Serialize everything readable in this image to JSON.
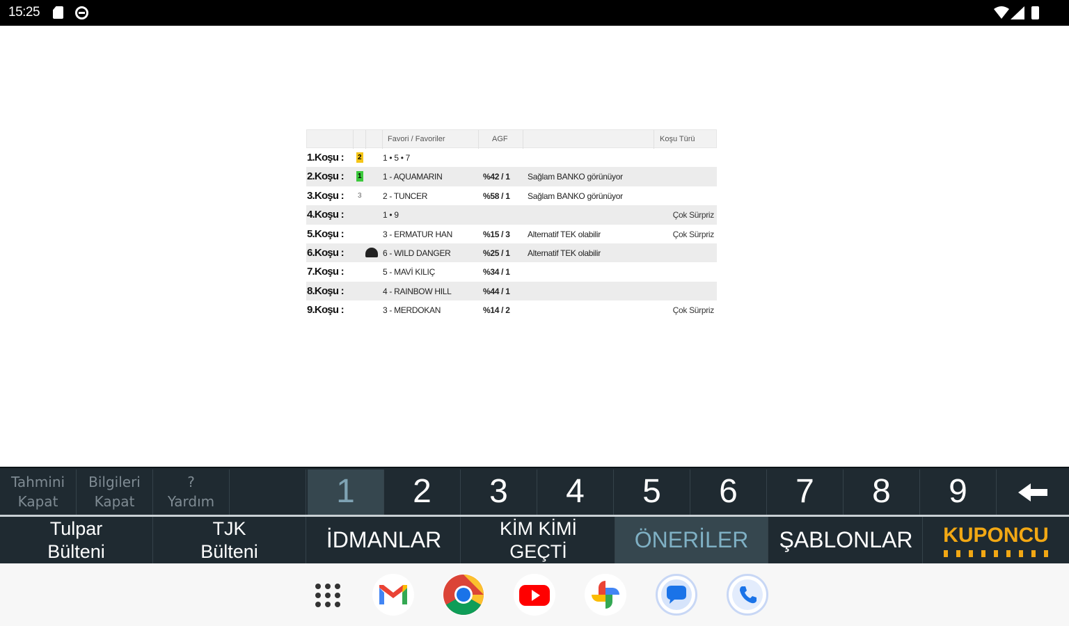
{
  "status_bar": {
    "time": "15:25"
  },
  "table": {
    "headers": {
      "favorites": "Favori / Favoriler",
      "agf": "AGF",
      "race_type": "Koşu Türü"
    },
    "rows": [
      {
        "race": "1.Koşu :",
        "badge": "2",
        "badge_color": "#f5c518",
        "pick": "1 • 5 • 7",
        "agf": "",
        "comment": "",
        "type": ""
      },
      {
        "race": "2.Koşu :",
        "badge": "1",
        "badge_color": "#3cc93c",
        "pick": "1 - AQUAMARIN",
        "agf": "%42 / 1",
        "comment": "Sağlam BANKO görünüyor",
        "type": ""
      },
      {
        "race": "3.Koşu :",
        "badge": "3",
        "badge_color": "",
        "pick": "2 - TUNCER",
        "agf": "%58 / 1",
        "comment": "Sağlam BANKO görünüyor",
        "type": ""
      },
      {
        "race": "4.Koşu :",
        "badge": "",
        "badge_color": "",
        "pick": "1 • 9",
        "agf": "",
        "comment": "",
        "type": "Çok Sürpriz"
      },
      {
        "race": "5.Koşu :",
        "badge": "",
        "badge_color": "",
        "pick": "3 - ERMATUR HAN",
        "agf": "%15 / 3",
        "comment": "Alternatif TEK olabilir",
        "type": "Çok Sürpriz"
      },
      {
        "race": "6.Koşu :",
        "badge": "",
        "badge_color": "",
        "pick": "6 - WILD DANGER",
        "agf": "%25 / 1",
        "comment": "Alternatif TEK olabilir",
        "type": ""
      },
      {
        "race": "7.Koşu :",
        "badge": "",
        "badge_color": "",
        "pick": "5 - MAVİ KILIÇ",
        "agf": "%34 / 1",
        "comment": "",
        "type": ""
      },
      {
        "race": "8.Koşu :",
        "badge": "",
        "badge_color": "",
        "pick": "4 - RAINBOW HILL",
        "agf": "%44 / 1",
        "comment": "",
        "type": ""
      },
      {
        "race": "9.Koşu :",
        "badge": "",
        "badge_color": "",
        "pick": "3 - MERDOKAN",
        "agf": "%14 / 2",
        "comment": "",
        "type": "Çok Sürpriz"
      }
    ]
  },
  "toolbar": {
    "hide_prediction": "Tahmini\nKapat",
    "hide_info": "Bilgileri\nKapat",
    "help": "?\nYardım",
    "numbers": [
      "1",
      "2",
      "3",
      "4",
      "5",
      "6",
      "7",
      "8",
      "9"
    ],
    "active_number": "1",
    "back_label": "🡐"
  },
  "menu": {
    "tulpar": "Tulpar\nBülteni",
    "tjk": "TJK\nBülteni",
    "idmanlar": "İDMANLAR",
    "kim_kimi": "KİM KİMİ\nGEÇTİ",
    "oneriler": "ÖNERİLER",
    "sablonlar": "ŞABLONLAR",
    "kuponcu": "KUPONCU"
  },
  "taskbar": {
    "apps": [
      "app-drawer-icon",
      "gmail-icon",
      "chrome-icon",
      "youtube-icon",
      "photos-icon",
      "messages-icon",
      "phone-icon"
    ]
  },
  "colors": {
    "bar_bg": "#1f2a31",
    "active_bg": "#36474f",
    "kuponcu": "#f2a814"
  }
}
